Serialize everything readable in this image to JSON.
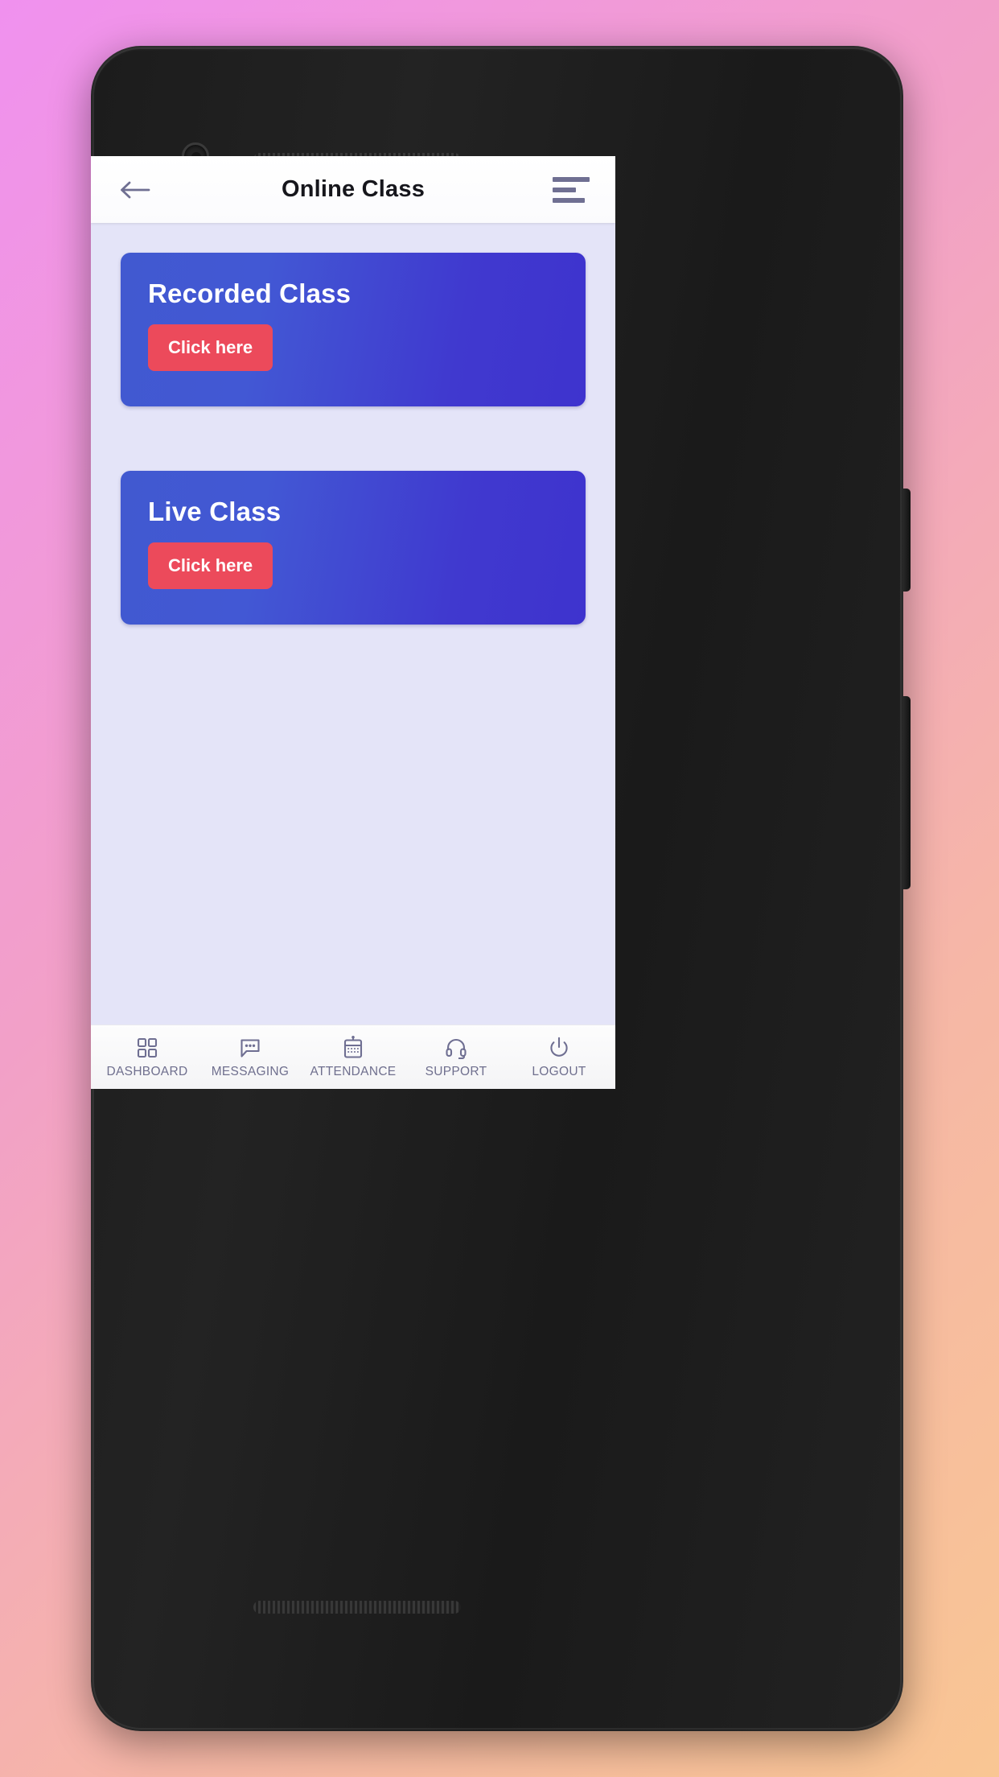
{
  "background": {
    "gradient_from": "#f091ef",
    "gradient_to": "#f9c693"
  },
  "device": {
    "frame_color": "#1f1f1f",
    "camera_icon": "camera-lens",
    "earpiece_icon": "speaker-grille"
  },
  "app_bar": {
    "back_icon": "arrow-left-icon",
    "title": "Online Class",
    "menu_icon": "hamburger-menu-icon",
    "background": "#ffffff",
    "title_color": "#16161c",
    "icon_color": "#6f6f92"
  },
  "screen": {
    "background": "#e4e4f8"
  },
  "cards": [
    {
      "id": "recorded-class",
      "title": "Recorded Class",
      "button_label": "Click here",
      "card_color": "#4159d0",
      "button_color": "#ec4a5b"
    },
    {
      "id": "live-class",
      "title": "Live Class",
      "button_label": "Click here",
      "card_color": "#4159d0",
      "button_color": "#ec4a5b"
    }
  ],
  "bottom_nav": {
    "text_color": "#6f6f8e",
    "items": [
      {
        "label": "DASHBOARD",
        "icon": "grid-squares-icon"
      },
      {
        "label": "MESSAGING",
        "icon": "chat-bubble-dots-icon"
      },
      {
        "label": "ATTENDANCE",
        "icon": "calendar-device-icon"
      },
      {
        "label": "SUPPORT",
        "icon": "headset-icon"
      },
      {
        "label": "LOGOUT",
        "icon": "power-icon"
      }
    ]
  }
}
